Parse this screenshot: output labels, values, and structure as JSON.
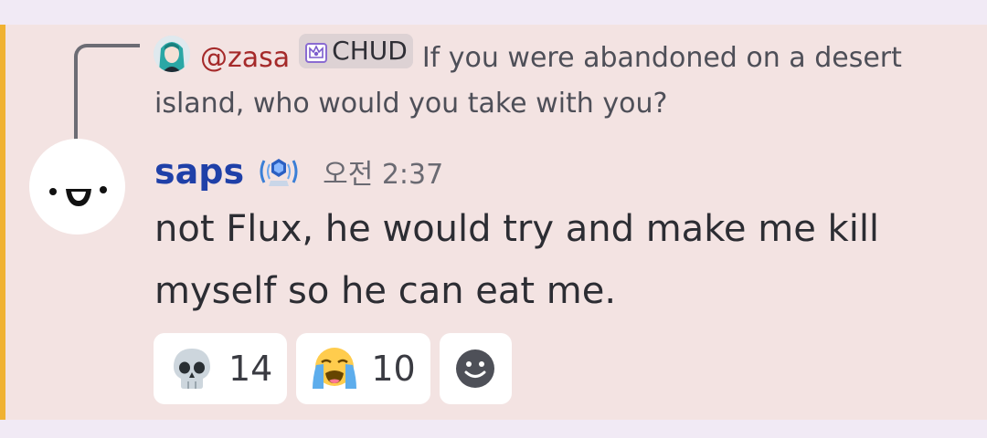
{
  "reply": {
    "username": "@zasa",
    "role_tag": "CHUD",
    "text": "If you were abandoned on a desert island, who would you take with you?"
  },
  "message": {
    "username": "saps",
    "timestamp": "오전 2:37",
    "content": "not Flux, he would try and make me kill myself so he can eat me."
  },
  "reactions": [
    {
      "emoji": "skull-icon",
      "count": "14"
    },
    {
      "emoji": "loudly-crying-face-icon",
      "count": "10"
    }
  ],
  "colors": {
    "accent": "#f0b232",
    "message_bg": "#f3e3e2",
    "username": "#1f40a8",
    "reply_username": "#a52a2a"
  }
}
